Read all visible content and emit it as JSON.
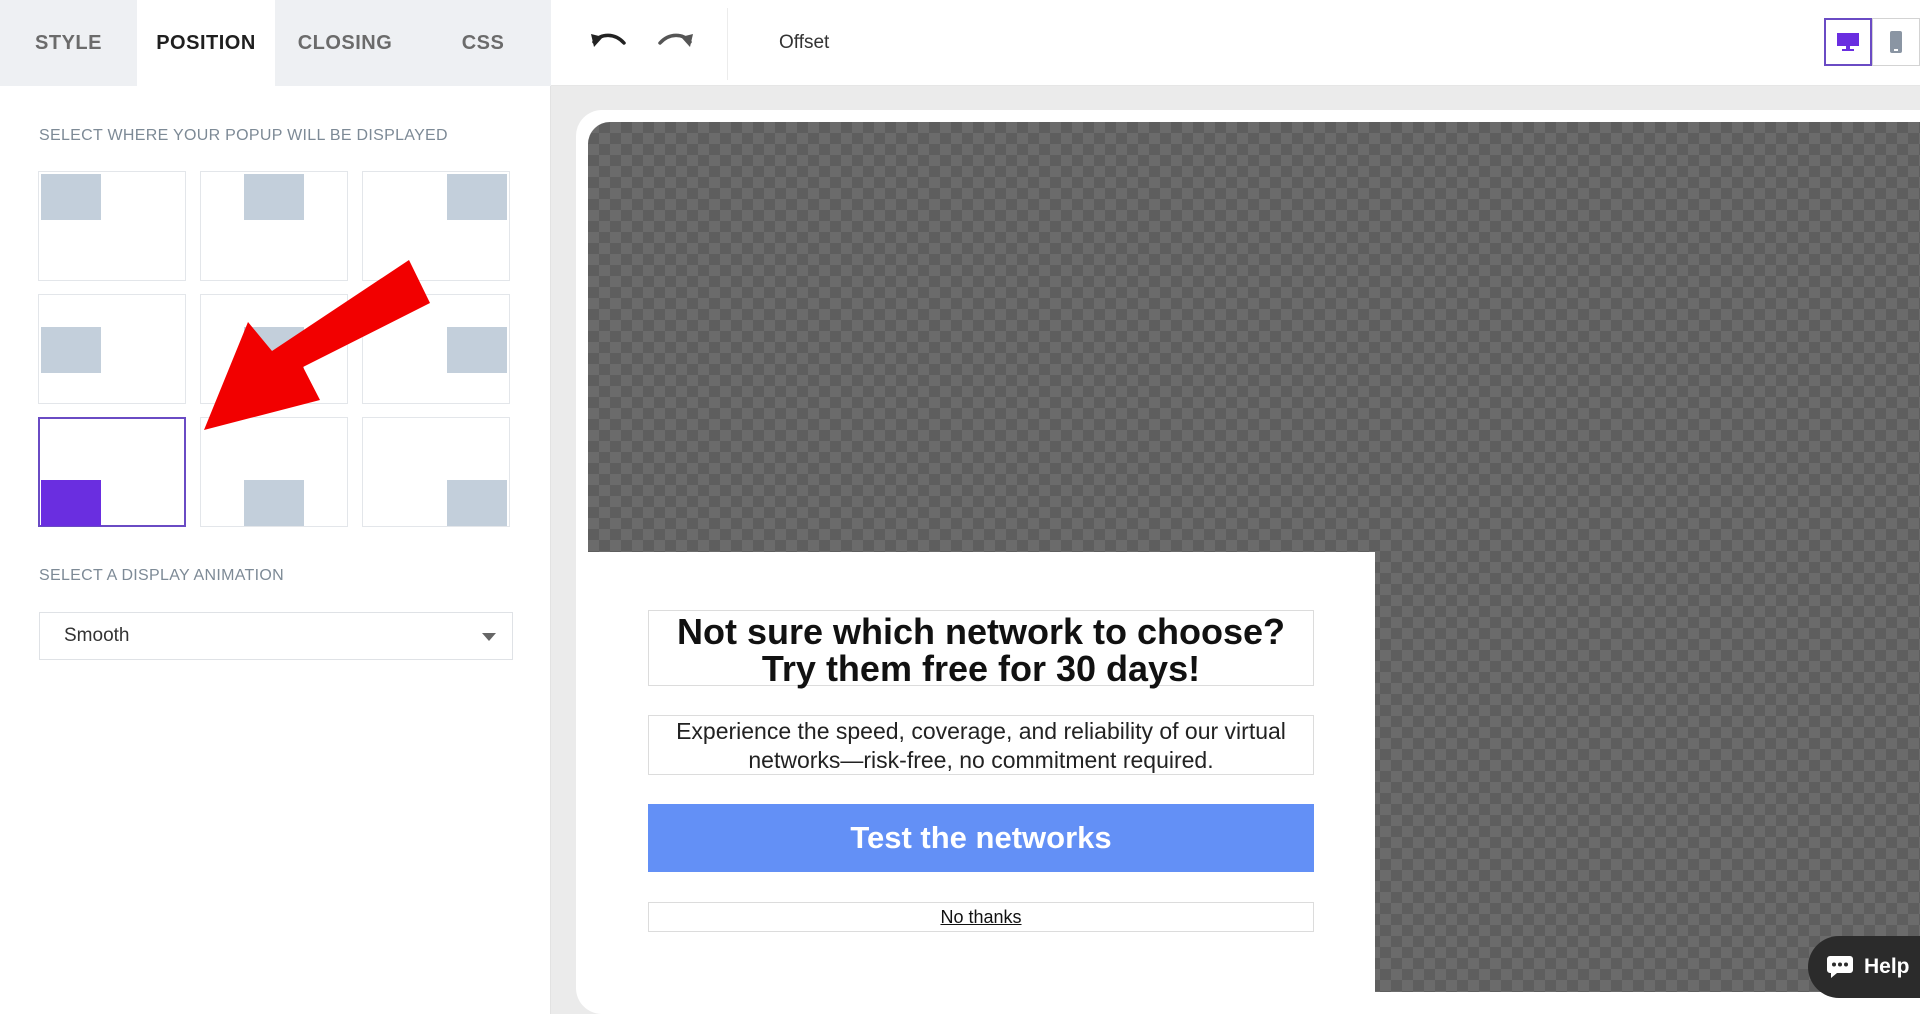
{
  "tabs": [
    {
      "label": "STYLE"
    },
    {
      "label": "POSITION"
    },
    {
      "label": "CLOSING"
    },
    {
      "label": "CSS"
    }
  ],
  "position_section": {
    "label": "SELECT WHERE YOUR POPUP WILL BE DISPLAYED",
    "options": [
      "top-left",
      "top-center",
      "top-right",
      "middle-left",
      "center",
      "middle-right",
      "bottom-left",
      "bottom-center",
      "bottom-right"
    ],
    "selected": "bottom-left"
  },
  "animation_section": {
    "label": "SELECT A DISPLAY ANIMATION",
    "value": "Smooth"
  },
  "toolbar": {
    "undo_icon": "undo-icon",
    "redo_icon": "redo-icon",
    "offset_label": "Offset",
    "devices": [
      "desktop-icon",
      "mobile-icon"
    ],
    "active_device": "desktop"
  },
  "popup": {
    "title_line1": "Not sure which network to choose?",
    "title_line2": "Try them free for 30 days!",
    "text_line1": "Experience the speed, coverage, and reliability of our virtual",
    "text_line2": "networks—risk-free, no commitment required.",
    "cta_label": "Test the networks",
    "dismiss_label": "No thanks",
    "cta_color": "#6390f6"
  },
  "help": {
    "label": "Help"
  },
  "colors": {
    "accent": "#6a2ee0",
    "arrow": "#f20000"
  }
}
